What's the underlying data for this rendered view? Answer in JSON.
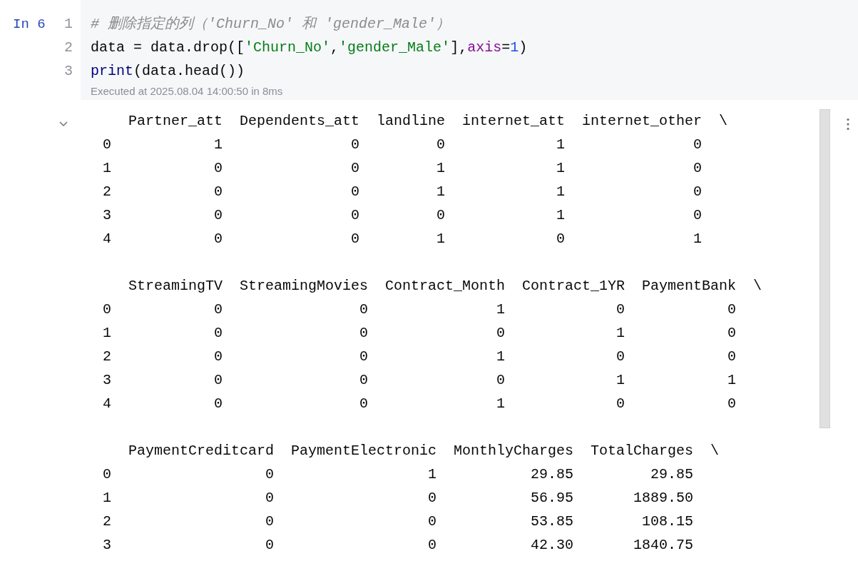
{
  "cell": {
    "prompt": "In 6",
    "code_lines": [
      {
        "number": "1",
        "tokens": [
          {
            "kind": "comment",
            "text": "# 删除指定的列（'Churn_No' 和 'gender_Male'）"
          }
        ]
      },
      {
        "number": "2",
        "tokens": [
          {
            "kind": "plain",
            "text": "data = data.drop(["
          },
          {
            "kind": "string",
            "text": "'Churn_No'"
          },
          {
            "kind": "plain",
            "text": ","
          },
          {
            "kind": "string",
            "text": "'gender_Male'"
          },
          {
            "kind": "plain",
            "text": "],"
          },
          {
            "kind": "param",
            "text": "axis"
          },
          {
            "kind": "plain",
            "text": "="
          },
          {
            "kind": "number",
            "text": "1"
          },
          {
            "kind": "plain",
            "text": ")"
          }
        ]
      },
      {
        "number": "3",
        "tokens": [
          {
            "kind": "builtin",
            "text": "print"
          },
          {
            "kind": "plain",
            "text": "(data.head())"
          }
        ]
      }
    ],
    "execution_info": "Executed at 2025.08.04 14:00:50 in 8ms",
    "output": {
      "expanded": true,
      "blocks": [
        {
          "columns": [
            "Partner_att",
            "Dependents_att",
            "landline",
            "internet_att",
            "internet_other"
          ],
          "continuation": "\\",
          "rows": [
            {
              "index": "0",
              "values": [
                "1",
                "0",
                "0",
                "1",
                "0"
              ]
            },
            {
              "index": "1",
              "values": [
                "0",
                "0",
                "1",
                "1",
                "0"
              ]
            },
            {
              "index": "2",
              "values": [
                "0",
                "0",
                "1",
                "1",
                "0"
              ]
            },
            {
              "index": "3",
              "values": [
                "0",
                "0",
                "0",
                "1",
                "0"
              ]
            },
            {
              "index": "4",
              "values": [
                "0",
                "0",
                "1",
                "0",
                "1"
              ]
            }
          ]
        },
        {
          "columns": [
            "StreamingTV",
            "StreamingMovies",
            "Contract_Month",
            "Contract_1YR",
            "PaymentBank"
          ],
          "continuation": "\\",
          "rows": [
            {
              "index": "0",
              "values": [
                "0",
                "0",
                "1",
                "0",
                "0"
              ]
            },
            {
              "index": "1",
              "values": [
                "0",
                "0",
                "0",
                "1",
                "0"
              ]
            },
            {
              "index": "2",
              "values": [
                "0",
                "0",
                "1",
                "0",
                "0"
              ]
            },
            {
              "index": "3",
              "values": [
                "0",
                "0",
                "0",
                "1",
                "1"
              ]
            },
            {
              "index": "4",
              "values": [
                "0",
                "0",
                "1",
                "0",
                "0"
              ]
            }
          ]
        },
        {
          "columns": [
            "PaymentCreditcard",
            "PaymentElectronic",
            "MonthlyCharges",
            "TotalCharges"
          ],
          "continuation": "\\",
          "rows": [
            {
              "index": "0",
              "values": [
                "0",
                "1",
                "29.85",
                "29.85"
              ]
            },
            {
              "index": "1",
              "values": [
                "0",
                "0",
                "56.95",
                "1889.50"
              ]
            },
            {
              "index": "2",
              "values": [
                "0",
                "0",
                "53.85",
                "108.15"
              ]
            },
            {
              "index": "3",
              "values": [
                "0",
                "0",
                "42.30",
                "1840.75"
              ]
            }
          ]
        }
      ]
    }
  }
}
